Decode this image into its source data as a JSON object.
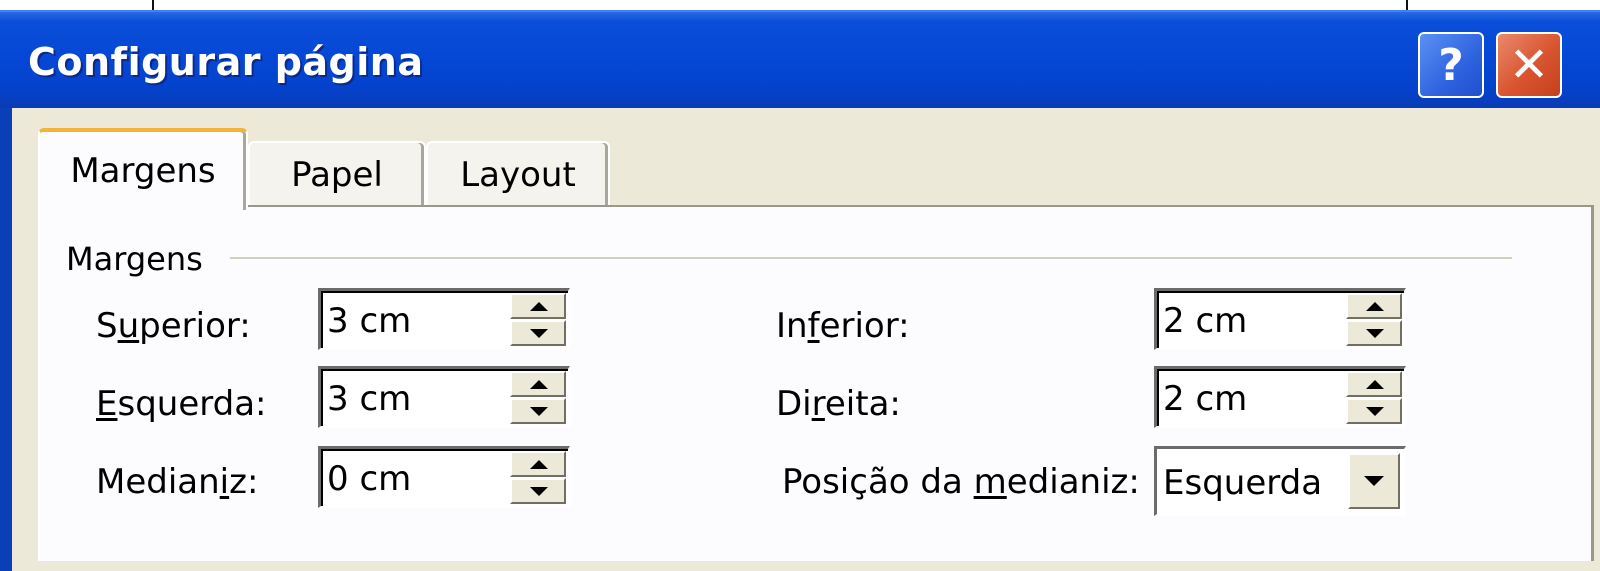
{
  "window": {
    "title": "Configurar página",
    "help_label": "?",
    "close_label": "✕",
    "accent_color": "#0548d6"
  },
  "tabs": [
    {
      "label": "Margens",
      "active": true
    },
    {
      "label": "Papel",
      "active": false
    },
    {
      "label": "Layout",
      "active": false
    }
  ],
  "margins_group": {
    "label": "Margens",
    "fields": {
      "superior": {
        "label_pre": "S",
        "label_ul": "u",
        "label_post": "perior:",
        "value": "3 cm"
      },
      "inferior": {
        "label_pre": "In",
        "label_ul": "f",
        "label_post": "erior:",
        "value": "2 cm"
      },
      "esquerda": {
        "label_pre": "",
        "label_ul": "E",
        "label_post": "squerda:",
        "value": "3 cm"
      },
      "direita": {
        "label_pre": "Di",
        "label_ul": "r",
        "label_post": "eita:",
        "value": "2 cm"
      },
      "medianiz": {
        "label_pre": "Median",
        "label_ul": "i",
        "label_post": "z:",
        "value": "0 cm"
      },
      "posicao": {
        "label_pre": "Posição da ",
        "label_ul": "m",
        "label_post": "edianiz:",
        "value": "Esquerda"
      }
    }
  },
  "icons": {
    "spin_up": "triangle-up-icon",
    "spin_down": "triangle-down-icon",
    "dropdown": "chevron-down-icon"
  }
}
